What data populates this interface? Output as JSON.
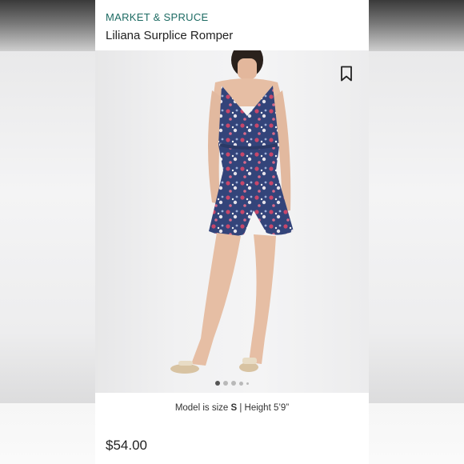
{
  "product": {
    "brand": "MARKET & SPRUCE",
    "name": "Liliana Surplice Romper",
    "price": "$54.00"
  },
  "model_info": {
    "prefix": "Model is size ",
    "size": "S",
    "separator": " | Height ",
    "height": "5’9”"
  },
  "gallery": {
    "total_images": 5,
    "active_index": 0
  },
  "icons": {
    "bookmark": "bookmark-icon"
  },
  "colors": {
    "brand": "#1d6b63",
    "dress_navy": "#2f3f73",
    "dress_pink": "#c8476a"
  }
}
